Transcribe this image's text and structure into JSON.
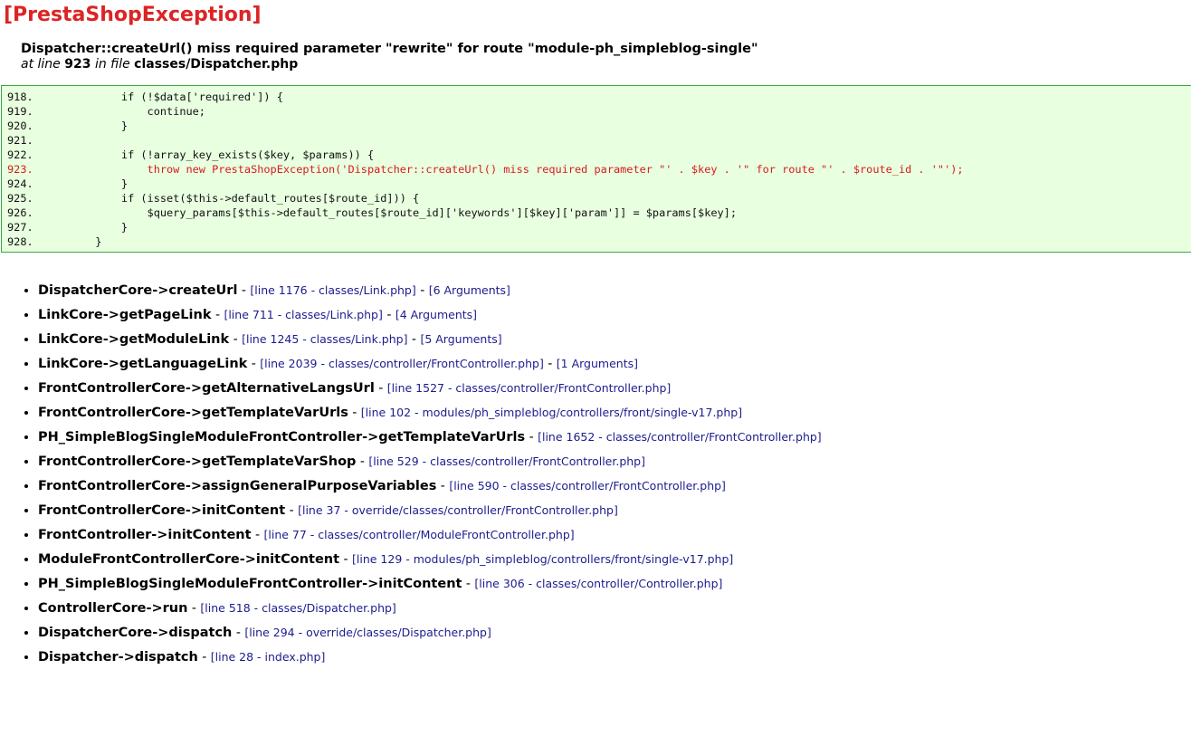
{
  "exception": {
    "title": "[PrestaShopException]",
    "message": "Dispatcher::createUrl() miss required parameter \"rewrite\" for route \"module-ph_simpleblog-single\"",
    "location": {
      "at_label": "at line",
      "line": "923",
      "in_label": "in file",
      "file": "classes/Dispatcher.php"
    }
  },
  "code": {
    "lines": [
      {
        "no": "918.",
        "text": "            if (!$data['required']) {",
        "highlight": false
      },
      {
        "no": "919.",
        "text": "                continue;",
        "highlight": false
      },
      {
        "no": "920.",
        "text": "            }",
        "highlight": false
      },
      {
        "no": "921.",
        "text": "",
        "highlight": false
      },
      {
        "no": "922.",
        "text": "            if (!array_key_exists($key, $params)) {",
        "highlight": false
      },
      {
        "no": "923.",
        "text": "                throw new PrestaShopException('Dispatcher::createUrl() miss required parameter \"' . $key . '\" for route \"' . $route_id . '\"');",
        "highlight": true
      },
      {
        "no": "924.",
        "text": "            }",
        "highlight": false
      },
      {
        "no": "925.",
        "text": "            if (isset($this->default_routes[$route_id])) {",
        "highlight": false
      },
      {
        "no": "926.",
        "text": "                $query_params[$this->default_routes[$route_id]['keywords'][$key]['param']] = $params[$key];",
        "highlight": false
      },
      {
        "no": "927.",
        "text": "            }",
        "highlight": false
      },
      {
        "no": "928.",
        "text": "        }",
        "highlight": false
      }
    ]
  },
  "trace": [
    {
      "fn": "DispatcherCore->createUrl",
      "loc": "[line 1176 - classes/Link.php]",
      "args": "[6 Arguments]"
    },
    {
      "fn": "LinkCore->getPageLink",
      "loc": "[line 711 - classes/Link.php]",
      "args": "[4 Arguments]"
    },
    {
      "fn": "LinkCore->getModuleLink",
      "loc": "[line 1245 - classes/Link.php]",
      "args": "[5 Arguments]"
    },
    {
      "fn": "LinkCore->getLanguageLink",
      "loc": "[line 2039 - classes/controller/FrontController.php]",
      "args": "[1 Arguments]"
    },
    {
      "fn": "FrontControllerCore->getAlternativeLangsUrl",
      "loc": "[line 1527 - classes/controller/FrontController.php]",
      "args": ""
    },
    {
      "fn": "FrontControllerCore->getTemplateVarUrls",
      "loc": "[line 102 - modules/ph_simpleblog/controllers/front/single-v17.php]",
      "args": ""
    },
    {
      "fn": "PH_SimpleBlogSingleModuleFrontController->getTemplateVarUrls",
      "loc": "[line 1652 - classes/controller/FrontController.php]",
      "args": ""
    },
    {
      "fn": "FrontControllerCore->getTemplateVarShop",
      "loc": "[line 529 - classes/controller/FrontController.php]",
      "args": ""
    },
    {
      "fn": "FrontControllerCore->assignGeneralPurposeVariables",
      "loc": "[line 590 - classes/controller/FrontController.php]",
      "args": ""
    },
    {
      "fn": "FrontControllerCore->initContent",
      "loc": "[line 37 - override/classes/controller/FrontController.php]",
      "args": ""
    },
    {
      "fn": "FrontController->initContent",
      "loc": "[line 77 - classes/controller/ModuleFrontController.php]",
      "args": ""
    },
    {
      "fn": "ModuleFrontControllerCore->initContent",
      "loc": "[line 129 - modules/ph_simpleblog/controllers/front/single-v17.php]",
      "args": ""
    },
    {
      "fn": "PH_SimpleBlogSingleModuleFrontController->initContent",
      "loc": "[line 306 - classes/controller/Controller.php]",
      "args": ""
    },
    {
      "fn": "ControllerCore->run",
      "loc": "[line 518 - classes/Dispatcher.php]",
      "args": ""
    },
    {
      "fn": "DispatcherCore->dispatch",
      "loc": "[line 294 - override/classes/Dispatcher.php]",
      "args": ""
    },
    {
      "fn": "Dispatcher->dispatch",
      "loc": "[line 28 - index.php]",
      "args": ""
    }
  ],
  "separator": " - ",
  "colors": {
    "title": "#dc2424",
    "code_background": "#e8ffe0",
    "code_border": "#39a845",
    "highlight": "#d81c1c",
    "link": "#1c1c8e"
  }
}
